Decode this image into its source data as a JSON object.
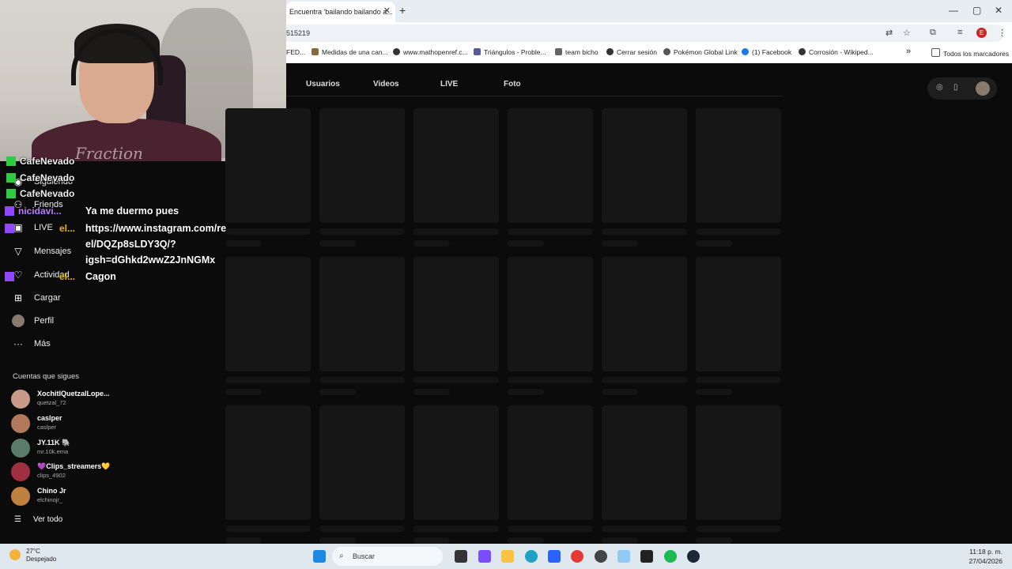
{
  "browser": {
    "tab_title": "Encuentra 'bailando bailando a...",
    "tab_close": "✕",
    "new_tab": "+",
    "url_text": "515219",
    "bookmarks": [
      "FED...",
      "Medidas de una can...",
      "www.mathopenref.c...",
      "Triángulos - Proble...",
      "team bicho",
      "Cerrar sesión",
      "Pokémon Global Link",
      "(1) Facebook",
      "Corrosión - Wikiped..."
    ],
    "more_bookmarks": "»",
    "all_bookmarks": "Todos los marcadores",
    "profile_letter": "E"
  },
  "webcam": {
    "shirt_text": "Fraction"
  },
  "sidebar": {
    "nav": [
      {
        "label": "Siguiendo",
        "icon": "following-icon"
      },
      {
        "label": "Friends",
        "icon": "friends-icon"
      },
      {
        "label": "LIVE",
        "icon": "live-icon"
      },
      {
        "label": "Mensajes",
        "icon": "messages-icon"
      },
      {
        "label": "Actividad",
        "icon": "activity-icon"
      },
      {
        "label": "Cargar",
        "icon": "upload-icon"
      },
      {
        "label": "Perfil",
        "icon": "profile-icon"
      },
      {
        "label": "Más",
        "icon": "more-icon"
      }
    ],
    "following_heading": "Cuentas que sigues",
    "accounts": [
      {
        "name": "XochitlQuetzalLope...",
        "handle": "quetzal_72",
        "color": "#c79a8a"
      },
      {
        "name": "caslper",
        "handle": "caslper",
        "color": "#b07a5a"
      },
      {
        "name": "JY.11K 🐘",
        "handle": "mr.10k.ema",
        "color": "#5a7a6a"
      },
      {
        "name": "💜Clips_streamers💛",
        "handle": "clips_4902",
        "color": "#a03040"
      },
      {
        "name": "Chino Jr",
        "handle": "elchinojr_",
        "color": "#c08040"
      }
    ],
    "see_all": "Ver todo"
  },
  "tiktok": {
    "tabs": [
      "Usuarios",
      "Videos",
      "LIVE",
      "Foto"
    ]
  },
  "chat": {
    "rows": [
      {
        "user": "CafeNevado",
        "text": ""
      },
      {
        "user": "CafeNevado",
        "text": ""
      },
      {
        "user": "CafeNevado",
        "text": ""
      },
      {
        "user": "nicidavi...",
        "text": "Ya me duermo pues"
      },
      {
        "user": "el...",
        "text": "https://www.instagram.com/re"
      },
      {
        "user": "",
        "text": "el/DQZp8sLDY3Q/?"
      },
      {
        "user": "",
        "text": "igsh=dGhkd2wwZ2JnNGMx"
      },
      {
        "user": "el...",
        "text": "Cagon"
      }
    ]
  },
  "taskbar": {
    "temp": "27°C",
    "weather": "Despejado",
    "search_placeholder": "Buscar",
    "time": "11:18 p. m.",
    "date": "27/04/2026"
  }
}
